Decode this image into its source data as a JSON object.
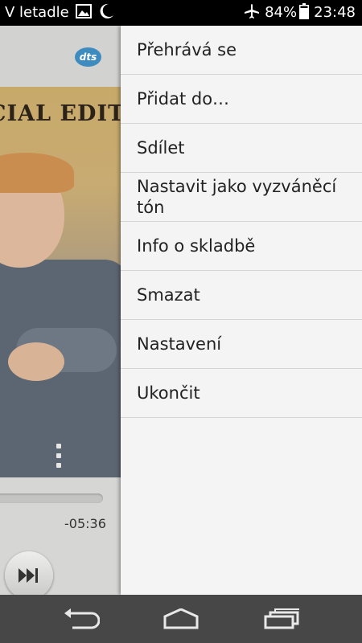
{
  "status_bar": {
    "carrier": "V letadle",
    "battery": "84%",
    "time": "23:48",
    "icons": [
      "gallery-icon",
      "moon-icon",
      "airplane-icon",
      "battery-icon"
    ]
  },
  "player": {
    "dts_logo": "dts",
    "album_text": "CIAL EDITION",
    "time_remaining": "-05:36"
  },
  "menu": {
    "items": [
      "Přehrává se",
      "Přidat do…",
      "Sdílet",
      "Nastavit jako vyzváněcí tón",
      "Info o skladbě",
      "Smazat",
      "Nastavení",
      "Ukončit"
    ]
  },
  "nav_bar": {
    "icons": [
      "back-icon",
      "home-icon",
      "recent-apps-icon"
    ],
    "color": "#474747"
  }
}
